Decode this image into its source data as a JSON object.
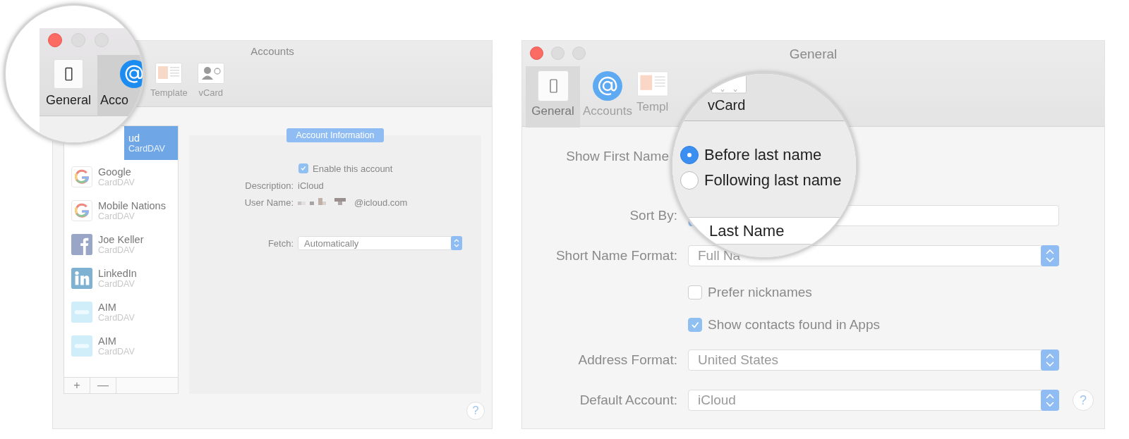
{
  "accounts_window": {
    "title": "Accounts",
    "toolbar": [
      {
        "label": "Template",
        "selected": false
      },
      {
        "label": "vCard",
        "selected": false
      }
    ],
    "lens": {
      "toolbar": [
        {
          "label": "General",
          "selected": false
        },
        {
          "label": "Acco",
          "selected": true
        }
      ]
    },
    "accounts": [
      {
        "name": "ud",
        "subtitle": "CardDAV",
        "kind": "partial",
        "selected": true
      },
      {
        "name": "Google",
        "subtitle": "CardDAV",
        "kind": "google",
        "selected": false
      },
      {
        "name": "Mobile Nations",
        "subtitle": "CardDAV",
        "kind": "google",
        "selected": false
      },
      {
        "name": "Joe Keller",
        "subtitle": "CardDAV",
        "kind": "facebook",
        "selected": false
      },
      {
        "name": "LinkedIn",
        "subtitle": "CardDAV",
        "kind": "linkedin",
        "selected": false
      },
      {
        "name": "AIM",
        "subtitle": "CardDAV",
        "kind": "aol",
        "selected": false
      },
      {
        "name": "AIM",
        "subtitle": "CardDAV",
        "kind": "aol",
        "selected": false
      }
    ],
    "list_buttons": [
      "+",
      "—"
    ],
    "section_title": "Account Information",
    "enable": {
      "label": "Enable this account",
      "checked": true
    },
    "fields": [
      {
        "label": "Description:",
        "value": "iCloud",
        "redacted": false
      },
      {
        "label": "User Name:",
        "value": "@icloud.com",
        "redacted": true
      }
    ],
    "fetch": {
      "label": "Fetch:",
      "value": "Automatically"
    },
    "help": "?"
  },
  "general_window": {
    "title": "General",
    "toolbar": [
      {
        "label": "General",
        "selected": true
      },
      {
        "label": "Accounts",
        "selected": false
      },
      {
        "label": "Templ",
        "selected": false
      }
    ],
    "lens": {
      "toolbar_label": "vCard",
      "radios": [
        {
          "label": "Before last name",
          "selected": true
        },
        {
          "label": "Following last name",
          "selected": false
        }
      ],
      "sort_value": "Last Name"
    },
    "rows": [
      {
        "kind": "label",
        "label": "Show First Name"
      },
      {
        "kind": "select",
        "label": "Sort By:"
      },
      {
        "kind": "select",
        "label": "Short Name Format:",
        "value": "Full Na"
      },
      {
        "kind": "checkbox",
        "label": "Prefer nicknames",
        "checked": false
      },
      {
        "kind": "checkbox",
        "label": "Show contacts found in Apps",
        "checked": true
      },
      {
        "kind": "select",
        "label": "Address Format:",
        "value": "United States"
      },
      {
        "kind": "select",
        "label": "Default Account:",
        "value": "iCloud",
        "help": "?"
      }
    ]
  }
}
